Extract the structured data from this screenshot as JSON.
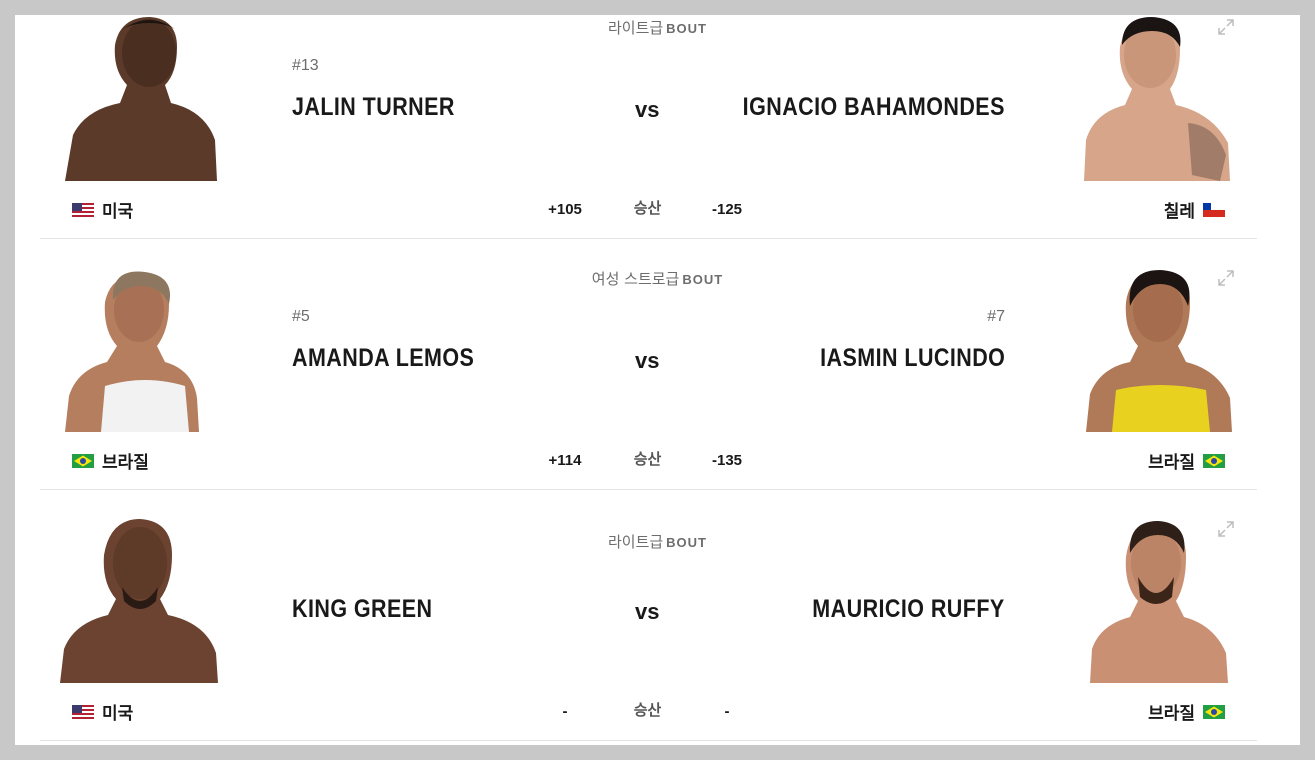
{
  "bouts": [
    {
      "weight_class": "라이트급",
      "bout_word": "BOUT",
      "vs_label": "vs",
      "odds_label": "승산",
      "left": {
        "rank": "#13",
        "name": "JALIN TURNER",
        "country": "미국",
        "flag": "usa",
        "odds": "+105"
      },
      "right": {
        "rank": "",
        "name": "IGNACIO BAHAMONDES",
        "country": "칠레",
        "flag": "chile",
        "odds": "-125"
      }
    },
    {
      "weight_class": "여성 스트로급",
      "bout_word": "BOUT",
      "vs_label": "vs",
      "odds_label": "승산",
      "left": {
        "rank": "#5",
        "name": "AMANDA LEMOS",
        "country": "브라질",
        "flag": "brazil",
        "odds": "+114"
      },
      "right": {
        "rank": "#7",
        "name": "IASMIN LUCINDO",
        "country": "브라질",
        "flag": "brazil",
        "odds": "-135"
      }
    },
    {
      "weight_class": "라이트급",
      "bout_word": "BOUT",
      "vs_label": "vs",
      "odds_label": "승산",
      "left": {
        "rank": "",
        "name": "KING GREEN",
        "country": "미국",
        "flag": "usa",
        "odds": "-"
      },
      "right": {
        "rank": "",
        "name": "MAURICIO RUFFY",
        "country": "브라질",
        "flag": "brazil",
        "odds": "-"
      }
    }
  ],
  "icons": {
    "expand": "expand-icon"
  },
  "colors": {
    "text": "#191919",
    "muted": "#6d6d6d",
    "divider": "#e4e4e4"
  }
}
